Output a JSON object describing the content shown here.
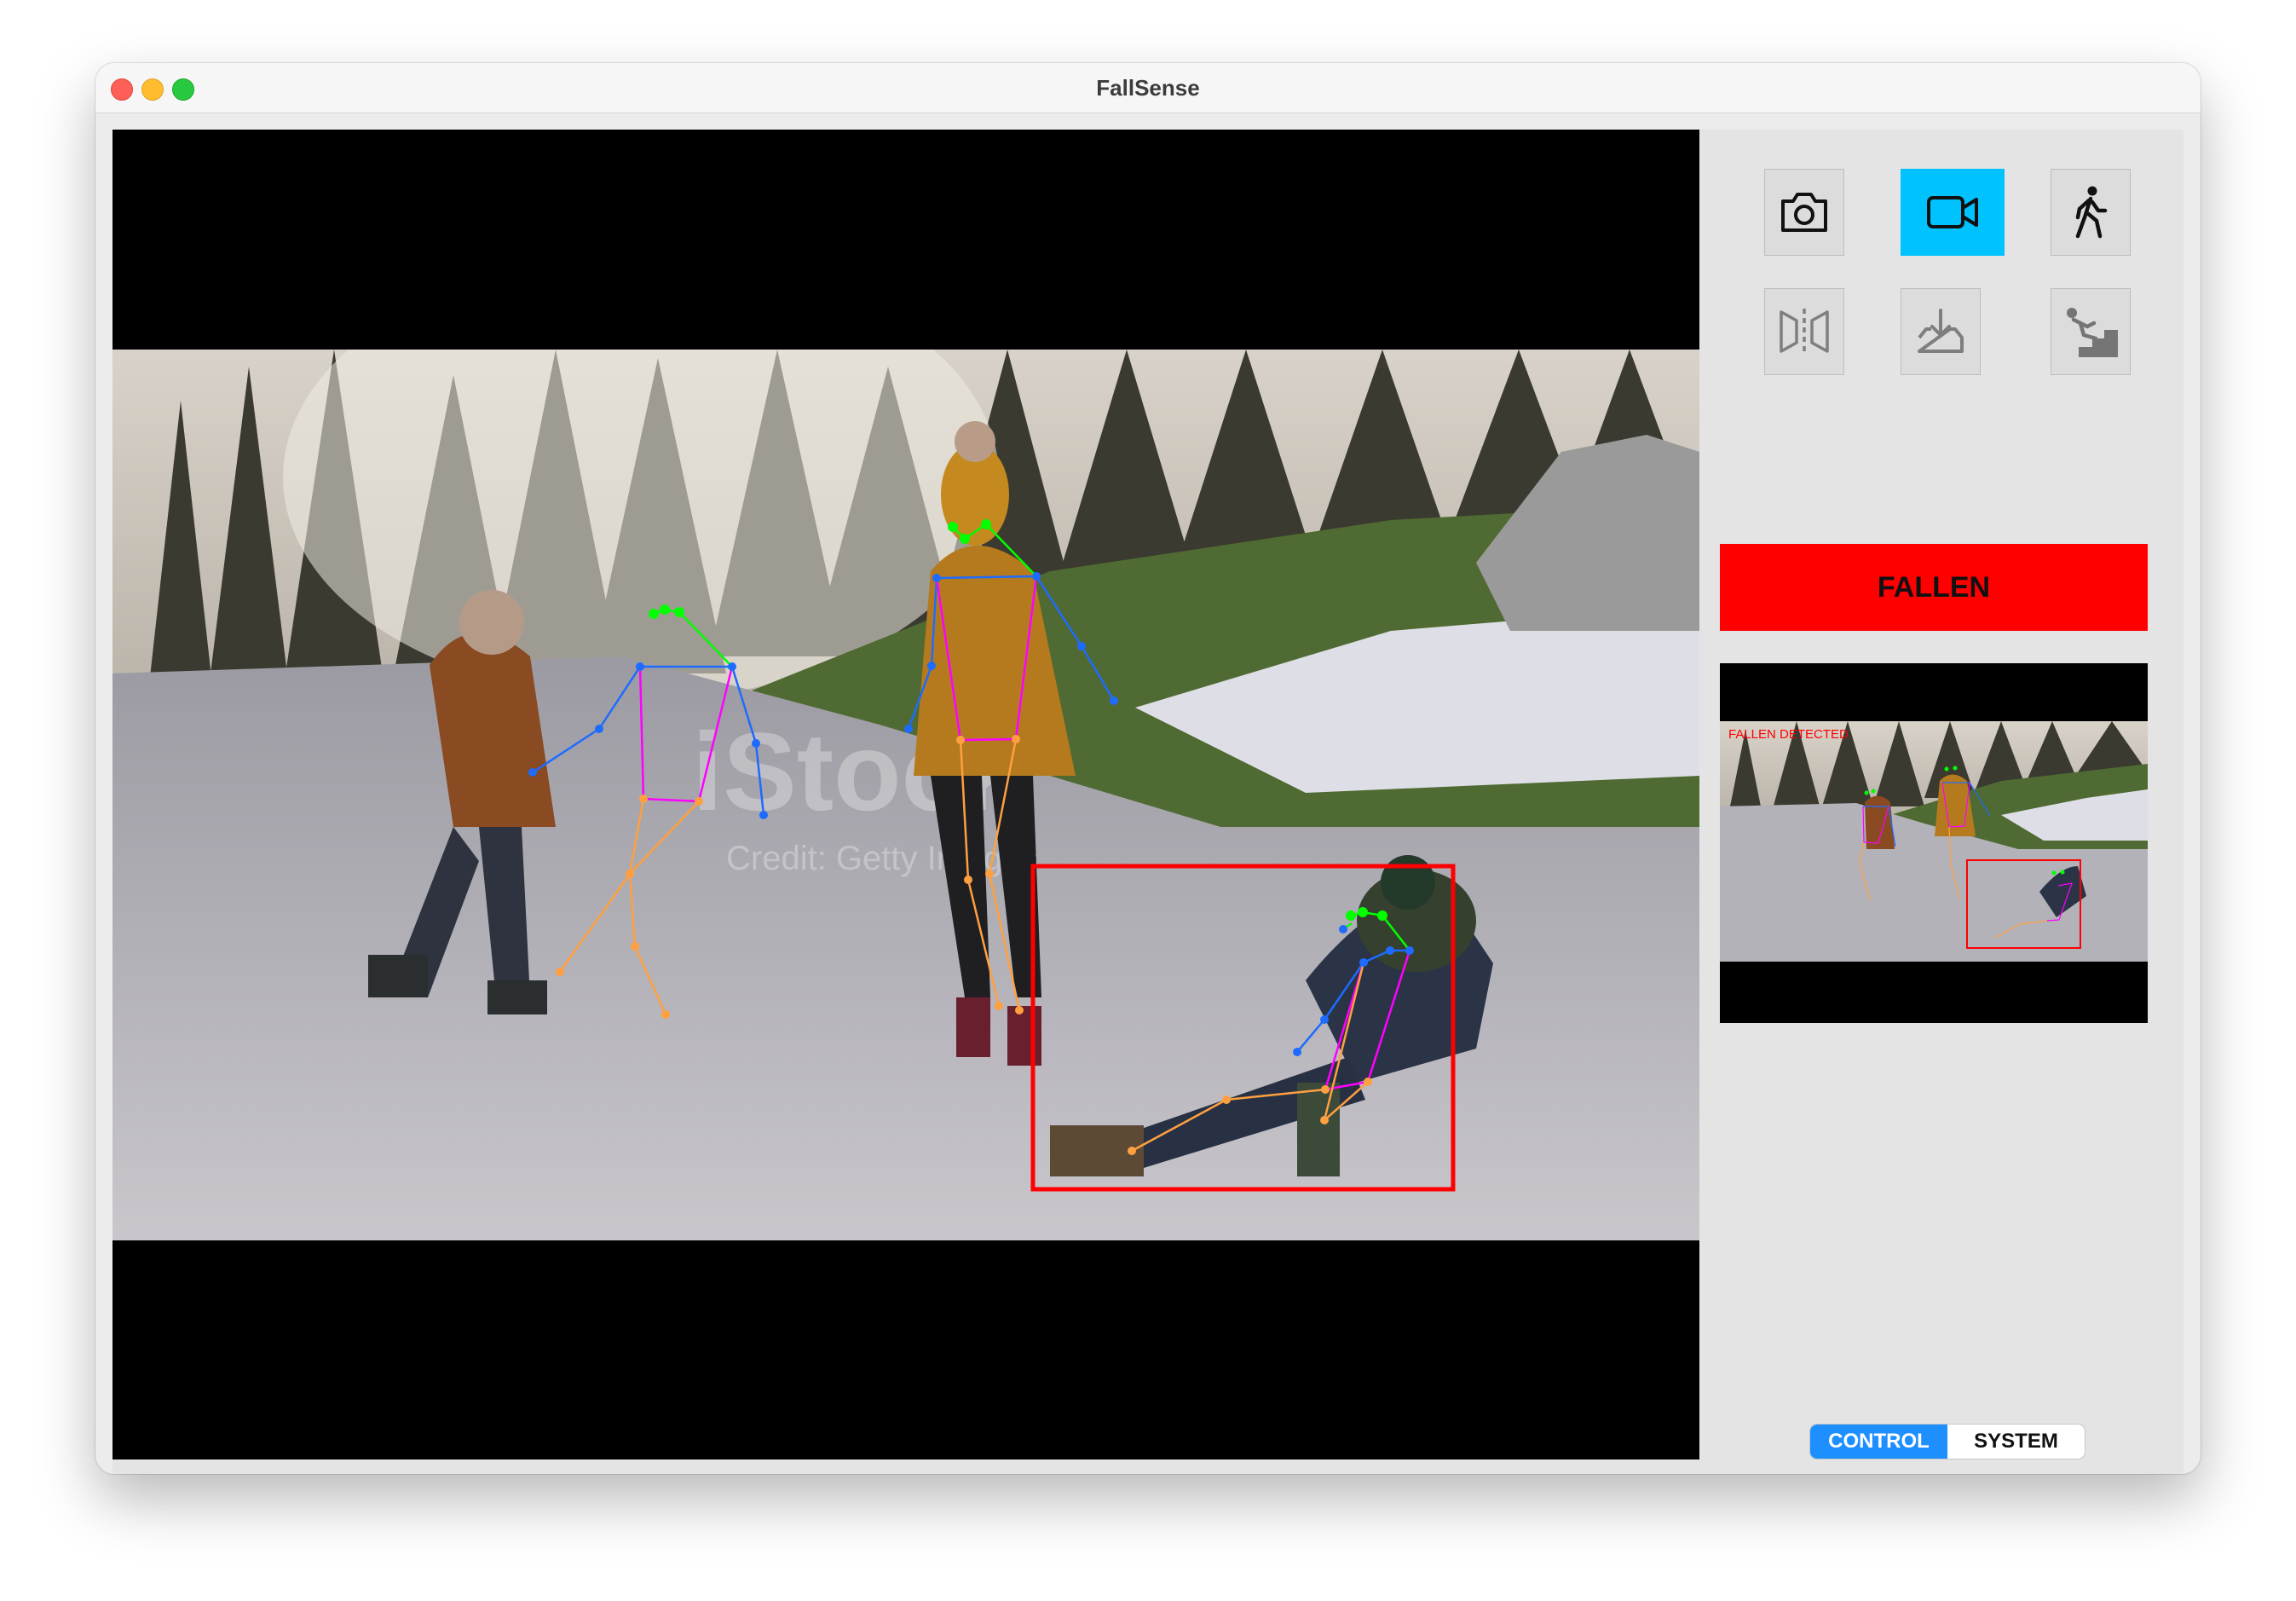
{
  "window": {
    "title": "FallSense"
  },
  "tools": [
    {
      "icon": "camera-icon",
      "state": "normal"
    },
    {
      "icon": "video-camera-icon",
      "state": "active"
    },
    {
      "icon": "person-walking-icon",
      "state": "normal"
    },
    {
      "icon": "mirror-flip-icon",
      "state": "disabled"
    },
    {
      "icon": "download-icon",
      "state": "disabled"
    },
    {
      "icon": "person-falling-stairs-icon",
      "state": "disabled"
    }
  ],
  "status": {
    "label": "FALLEN",
    "color": "#ff0000"
  },
  "preview": {
    "overlay_text": "FALLEN DETECTED"
  },
  "video": {
    "watermark": "iStock",
    "watermark_sub": "Credit: Getty Images"
  },
  "tabs": [
    {
      "label": "CONTROL",
      "selected": true
    },
    {
      "label": "SYSTEM",
      "selected": false
    }
  ],
  "colors": {
    "accent": "#00c2ff",
    "tab_selected": "#1e8fff",
    "detection_box": "#ff0000"
  }
}
